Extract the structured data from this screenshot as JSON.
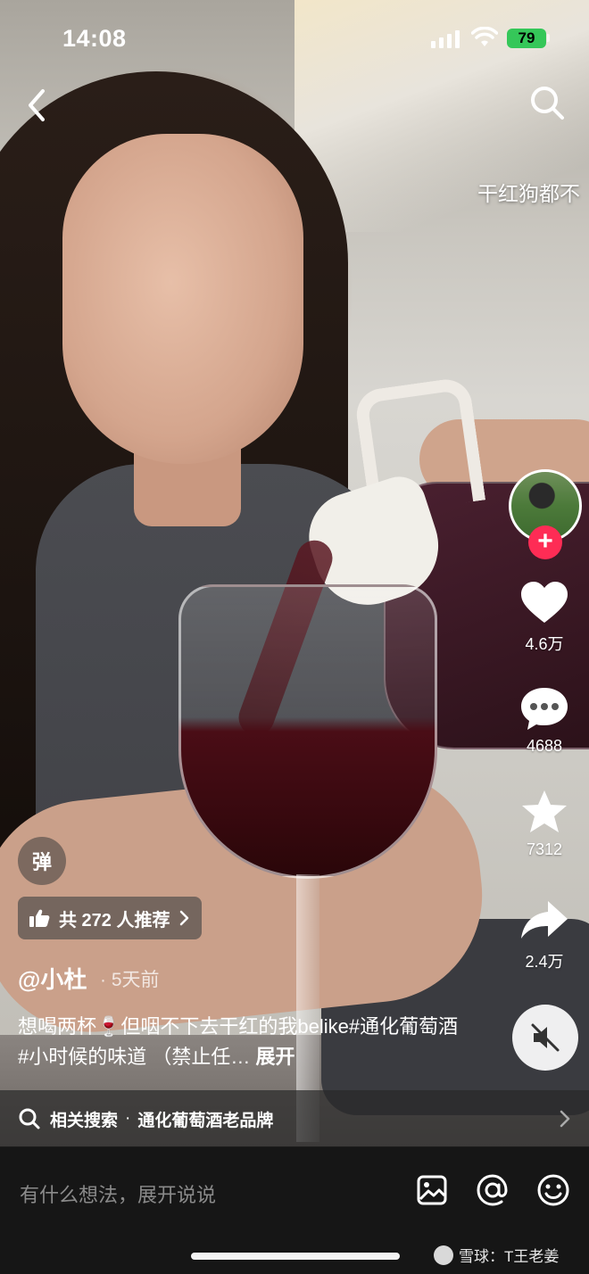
{
  "status_bar": {
    "time": "14:08",
    "battery": "79"
  },
  "danmaku": "干红狗都不",
  "rail": {
    "likes": "4.6万",
    "comments": "4688",
    "favorites": "7312",
    "shares": "2.4万",
    "follow_symbol": "+"
  },
  "overlay": {
    "danmu_toggle": "弹",
    "recommend": "共 272 人推荐",
    "author": "@小杜",
    "time_ago": "· 5天前",
    "caption_text": "想喝两杯🍷但咽不下去干红的我belike#通化葡萄酒#小时候的味道 （禁止任…",
    "caption_expand": "展开"
  },
  "related_search": {
    "label": "相关搜索",
    "separator": "·",
    "term": "通化葡萄酒老品牌"
  },
  "bottom_bar": {
    "comment_placeholder": "有什么想法，展开说说",
    "watermark": "雪球：T王老姜"
  },
  "colors": {
    "follow": "#fe2c55",
    "battery": "#35c759",
    "bottom_bar": "#161616"
  }
}
